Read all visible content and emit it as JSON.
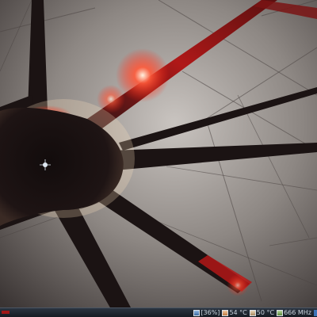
{
  "wallpaper": {
    "subject": "neuron",
    "accent_color": "#e02020",
    "soma_glow_color": "#ffd6b0"
  },
  "taskbar": {
    "applets": [
      {
        "icon": "battery-icon",
        "value": "[36%]"
      },
      {
        "icon": "cpu-temp-icon",
        "value": "54 °C"
      },
      {
        "icon": "disk-temp-icon",
        "value": "50 °C"
      },
      {
        "icon": "cpu-frequency-icon",
        "value": "666 MHz"
      }
    ]
  }
}
